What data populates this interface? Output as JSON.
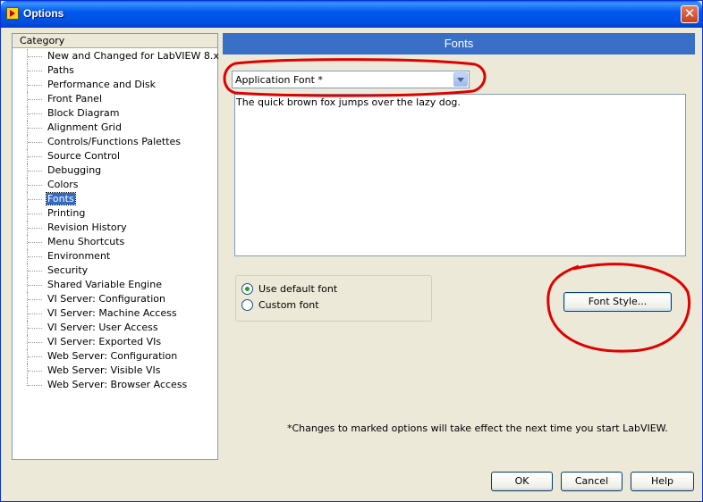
{
  "window": {
    "title": "Options",
    "close_symbol": "✕"
  },
  "category": {
    "header": "Category",
    "selected_index": 10,
    "items": [
      {
        "label": "New and Changed for LabVIEW 8.x"
      },
      {
        "label": "Paths"
      },
      {
        "label": "Performance and Disk"
      },
      {
        "label": "Front Panel"
      },
      {
        "label": "Block Diagram"
      },
      {
        "label": "Alignment Grid"
      },
      {
        "label": "Controls/Functions Palettes"
      },
      {
        "label": "Source Control"
      },
      {
        "label": "Debugging"
      },
      {
        "label": "Colors"
      },
      {
        "label": "Fonts"
      },
      {
        "label": "Printing"
      },
      {
        "label": "Revision History"
      },
      {
        "label": "Menu Shortcuts"
      },
      {
        "label": "Environment"
      },
      {
        "label": "Security"
      },
      {
        "label": "Shared Variable Engine"
      },
      {
        "label": "VI Server: Configuration"
      },
      {
        "label": "VI Server: Machine Access"
      },
      {
        "label": "VI Server: User Access"
      },
      {
        "label": "VI Server: Exported VIs"
      },
      {
        "label": "Web Server: Configuration"
      },
      {
        "label": "Web Server: Visible VIs"
      },
      {
        "label": "Web Server: Browser Access"
      }
    ]
  },
  "fonts": {
    "section_title": "Fonts",
    "font_select": {
      "value": "Application Font *"
    },
    "preview_text": "The quick brown fox jumps over the lazy dog.",
    "radios": [
      {
        "label": "Use default font",
        "checked": true
      },
      {
        "label": "Custom font",
        "checked": false
      }
    ],
    "font_style_button": "Font Style...",
    "footnote": "*Changes to marked options will take effect the next time you start LabVIEW."
  },
  "buttons": {
    "ok": "OK",
    "cancel": "Cancel",
    "help": "Help"
  },
  "colors": {
    "title_bar": "#0058ee",
    "section_header": "#3a6fc7",
    "selection": "#316ac5",
    "annotation": "#e00000"
  }
}
